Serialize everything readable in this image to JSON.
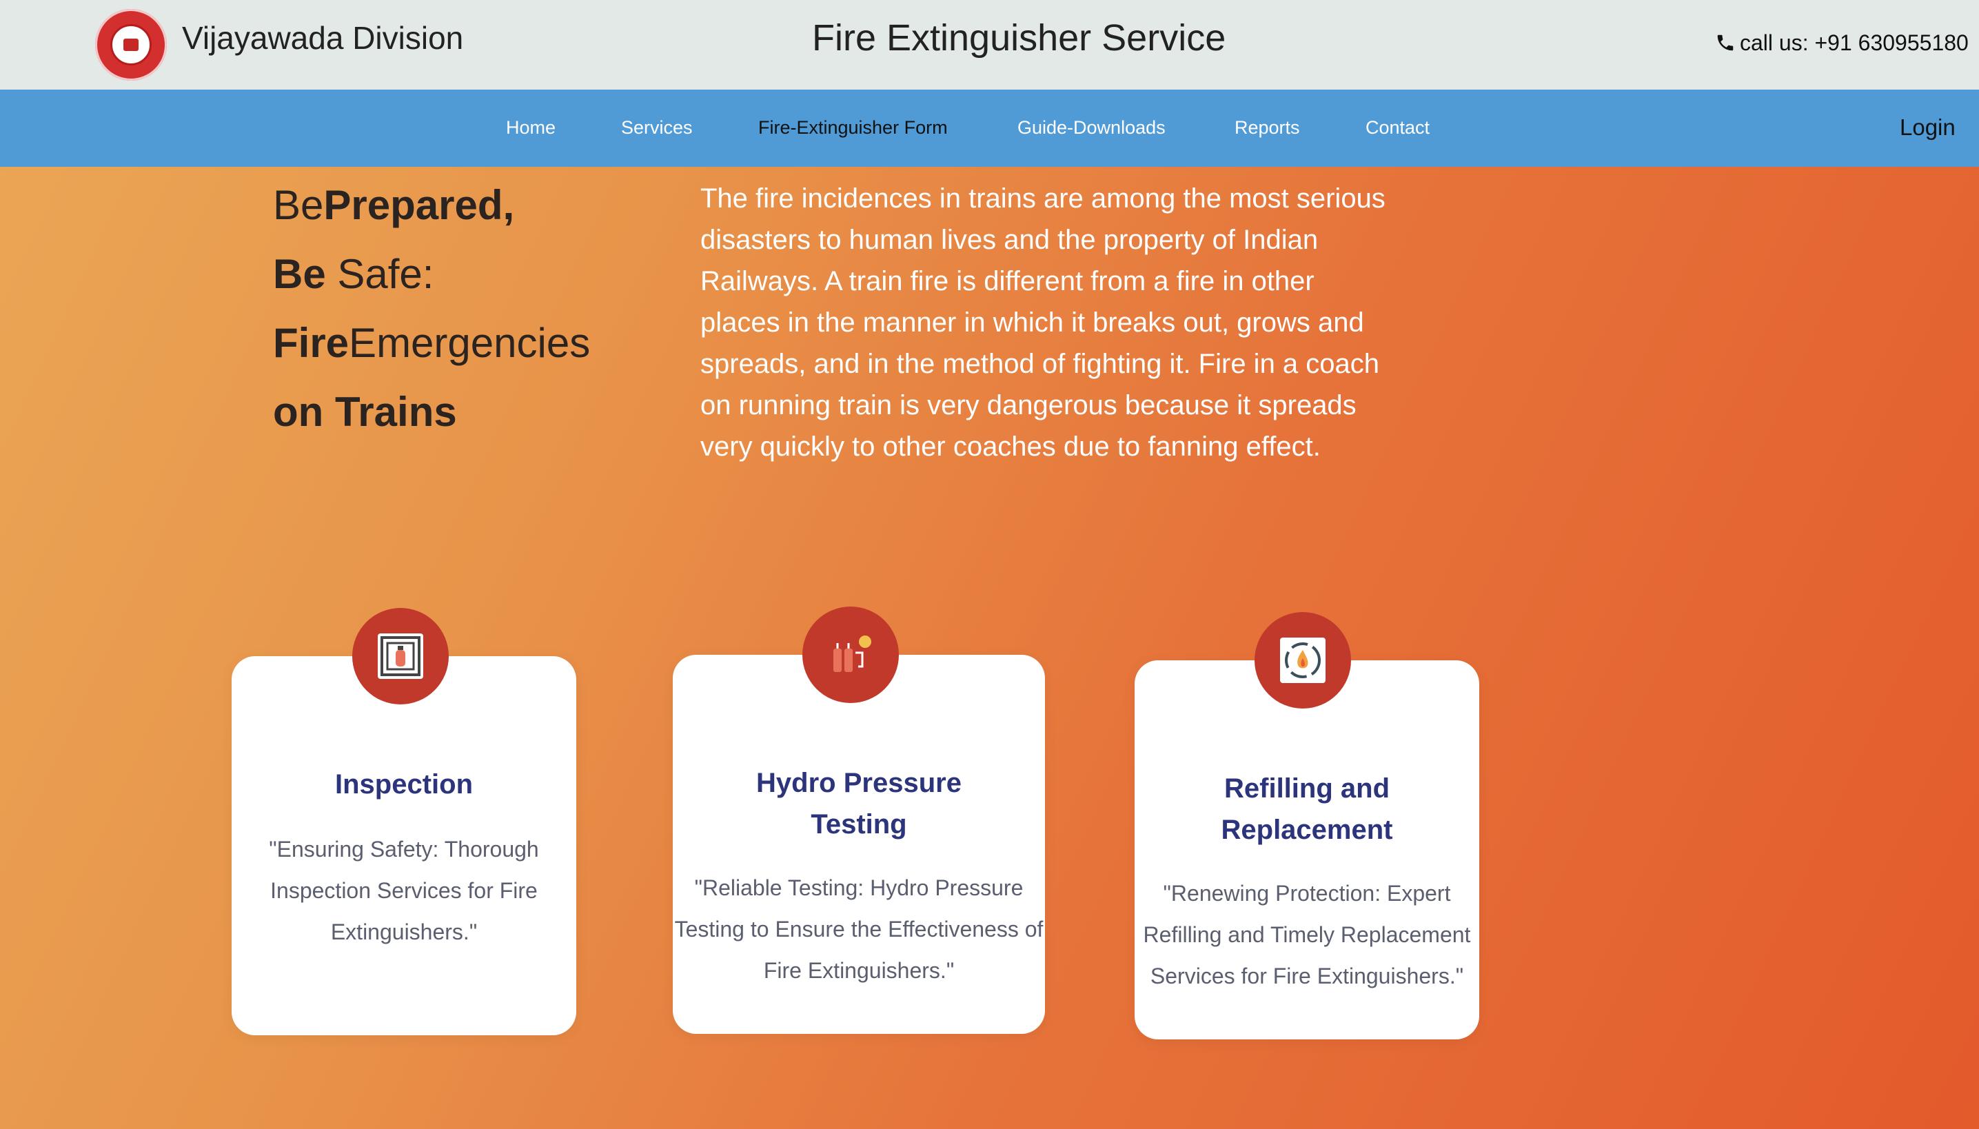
{
  "header": {
    "division": "Vijayawada Division",
    "title": "Fire Extinguisher Service",
    "call_text": "call us: +91 630955180"
  },
  "nav": {
    "items": [
      "Home",
      "Services",
      "Fire-Extinguisher Form",
      "Guide-Downloads",
      "Reports",
      "Contact"
    ],
    "login": "Login"
  },
  "hero": {
    "tagline": {
      "l1a": "Be",
      "l1b": "Prepared,",
      "l2a": "Be",
      "l2b": " Safe:",
      "l3a": "Fire",
      "l3b": "Emergencies",
      "l4": "on Trains"
    },
    "text": "The fire incidences in trains are among the most serious disasters to human lives and the property of Indian Railways. A train fire is different from a fire in other places in the manner in which it breaks out, grows and spreads, and in the method of fighting it. Fire in a coach on running train is very dangerous because it spreads very quickly to other coaches due to fanning effect."
  },
  "cards": [
    {
      "title": "Inspection",
      "desc": "\"Ensuring Safety: Thorough Inspection Services for Fire Extinguishers.\"",
      "icon": "extinguisher-inspection-icon"
    },
    {
      "title": "Hydro Pressure Testing",
      "desc": "\"Reliable Testing: Hydro Pressure Testing to Ensure the Effectiveness of Fire Extinguishers.\"",
      "icon": "pressure-testing-icon"
    },
    {
      "title": "Refilling and Replacement",
      "desc": "\"Renewing Protection: Expert Refilling and Timely Replacement Services for Fire Extinguishers.\"",
      "icon": "refill-cycle-icon"
    }
  ],
  "colors": {
    "topbar_bg": "#e3e9e6",
    "nav_bg": "#509bd5",
    "card_title": "#2c347c",
    "badge_red": "#c0392b"
  }
}
